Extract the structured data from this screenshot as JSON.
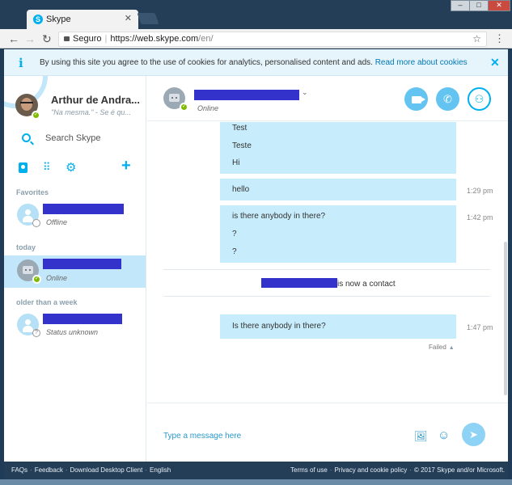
{
  "browser": {
    "tab_title": "Skype",
    "tab_close": "✕",
    "secure_label": "Seguro",
    "url_main": "https://web.skype.com",
    "url_rest": "/en/",
    "window_min": "–",
    "window_max": "□",
    "window_close": "✕"
  },
  "cookie_banner": {
    "text": "By using this site you agree to the use of cookies for analytics, personalised content and ads.",
    "link": "Read more about cookies",
    "close": "✕"
  },
  "profile": {
    "name": "Arthur de Andra...",
    "mood": "\"Na mesma.\" - Se é qu..."
  },
  "search": {
    "label": "Search Skype"
  },
  "sections": {
    "favorites": "Favorites",
    "today": "today",
    "older": "older than a week"
  },
  "contacts": [
    {
      "status": "Offline"
    },
    {
      "status": "Online"
    },
    {
      "status": "Status unknown"
    }
  ],
  "chat": {
    "status": "Online",
    "messages": {
      "block1": [
        "Test",
        "Teste",
        "Hi"
      ],
      "hello": "hello",
      "hello_time": "1:29 pm",
      "block2": [
        "is there anybody in there?",
        "?",
        "?"
      ],
      "block2_time": "1:42 pm",
      "system_text": "is now a contact",
      "last": "Is there anybody in there?",
      "last_time": "1:47 pm",
      "failed": "Failed"
    },
    "compose_placeholder": "Type a message here"
  },
  "footer": {
    "left": [
      "FAQs",
      "Feedback",
      "Download Desktop Client",
      "English"
    ],
    "right": [
      "Terms of use",
      "Privacy and cookie policy",
      "© 2017 Skype and/or Microsoft."
    ]
  },
  "icons": {
    "back": "back-arrow-icon",
    "forward": "forward-arrow-icon",
    "reload": "reload-icon",
    "star": "star-icon",
    "menu": "menu-dots-icon",
    "info": "info-icon",
    "search": "search-icon",
    "contacts": "contacts-book-icon",
    "dialpad": "dialpad-icon",
    "gear": "gear-icon",
    "add": "plus-icon",
    "video": "video-call-icon",
    "call": "phone-icon",
    "add_people": "add-people-icon",
    "media": "media-icon",
    "emoji": "emoji-icon",
    "send": "send-icon"
  },
  "colors": {
    "accent": "#00aff0",
    "bubble": "#c7ecfb",
    "online": "#7fba00",
    "redaction": "#3333cc",
    "footer_bg": "#243e58"
  }
}
